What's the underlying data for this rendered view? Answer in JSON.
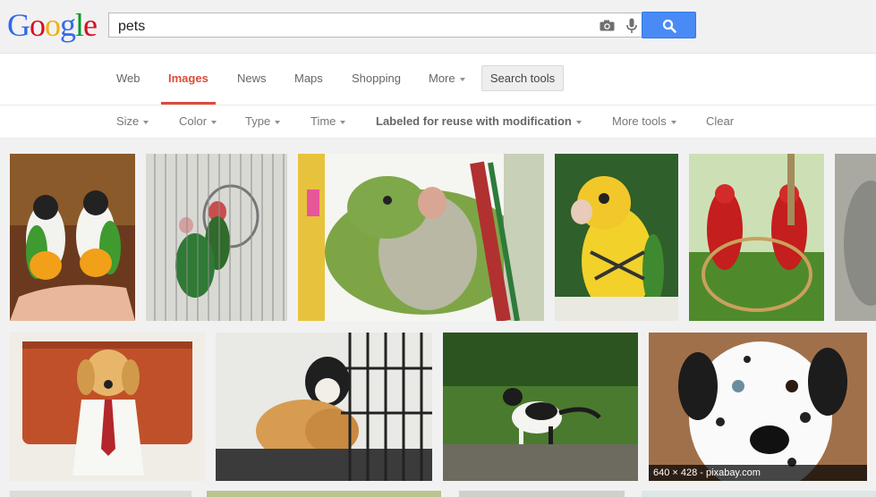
{
  "logo": {
    "text": "Google"
  },
  "search": {
    "query": "pets"
  },
  "tabs": [
    {
      "label": "Web"
    },
    {
      "label": "Images"
    },
    {
      "label": "News"
    },
    {
      "label": "Maps"
    },
    {
      "label": "Shopping"
    },
    {
      "label": "More"
    }
  ],
  "search_tools_label": "Search tools",
  "tools": [
    {
      "label": "Size"
    },
    {
      "label": "Color"
    },
    {
      "label": "Type"
    },
    {
      "label": "Time"
    },
    {
      "label": "Labeled for reuse with modification"
    },
    {
      "label": "More tools"
    },
    {
      "label": "Clear"
    }
  ],
  "colors": {
    "logo": [
      "#3369e8",
      "#d50f25",
      "#eeb211",
      "#3369e8",
      "#009925",
      "#d50f25"
    ],
    "accent": "#dd4b39",
    "search_button": "#4a8af4"
  },
  "images": {
    "hover_meta": "640 × 428 - pixabay.com"
  }
}
